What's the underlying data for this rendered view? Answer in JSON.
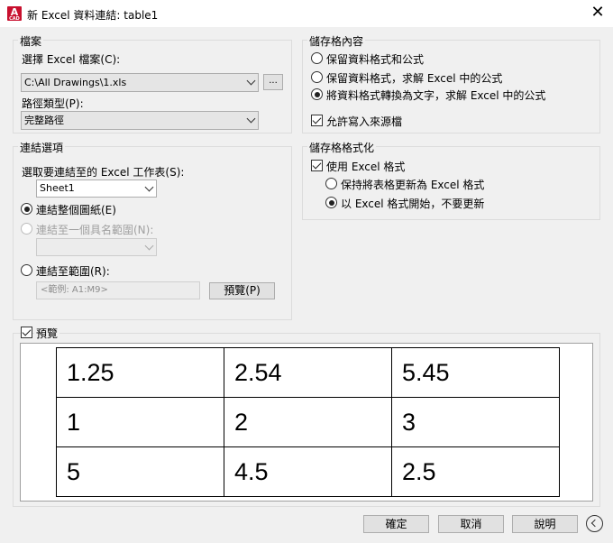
{
  "window": {
    "icon_letter": "A",
    "icon_sub": "CAD",
    "title": "新 Excel 資料連結: table1",
    "close_glyph": "✕"
  },
  "file_group": {
    "label": "檔案",
    "choose_label": "選擇 Excel 檔案(C):",
    "file_value": "C:\\All Drawings\\1.xls",
    "browse_label": "...",
    "path_type_label": "路徑類型(P):",
    "path_type_value": "完整路徑"
  },
  "link_options": {
    "label": "連結選項",
    "sheet_label": "選取要連結至的 Excel 工作表(S):",
    "sheet_value": "Sheet1",
    "opt_entire_sheet": "連結整個圖紙(E)",
    "opt_named_range": "連結至一個具名範圍(N):",
    "named_range_value": "",
    "opt_range": "連結至範圍(R):",
    "range_placeholder": "<範例: A1:M9>",
    "preview_button": "預覽(P)"
  },
  "cell_contents": {
    "label": "儲存格內容",
    "opt_keep_formats_formulas": "保留資料格式和公式",
    "opt_keep_formats_solve": "保留資料格式，求解 Excel 中的公式",
    "opt_convert_text": "將資料格式轉換為文字，求解 Excel 中的公式",
    "allow_writeback": "允許寫入來源檔"
  },
  "cell_format": {
    "label": "儲存格格式化",
    "use_excel_format": "使用 Excel 格式",
    "opt_keep_updating": "保持將表格更新為 Excel 格式",
    "opt_start_no_update": "以 Excel 格式開始，不要更新"
  },
  "preview": {
    "label": "預覽",
    "rows": [
      [
        "1.25",
        "2.54",
        "5.45"
      ],
      [
        "1",
        "2",
        "3"
      ],
      [
        "5",
        "4.5",
        "2.5"
      ]
    ]
  },
  "footer": {
    "ok": "確定",
    "cancel": "取消",
    "help": "說明"
  },
  "state": {
    "link_mode": "entire_sheet",
    "cell_contents_mode": "convert_text",
    "allow_writeback": true,
    "use_excel_format": true,
    "format_mode": "start_no_update",
    "preview_enabled": true
  },
  "colors": {
    "dialog_bg": "#f0f0f0",
    "titlebar_bg": "#ffffff",
    "app_icon": "#c8102e",
    "group_border": "#dcdcdc"
  }
}
